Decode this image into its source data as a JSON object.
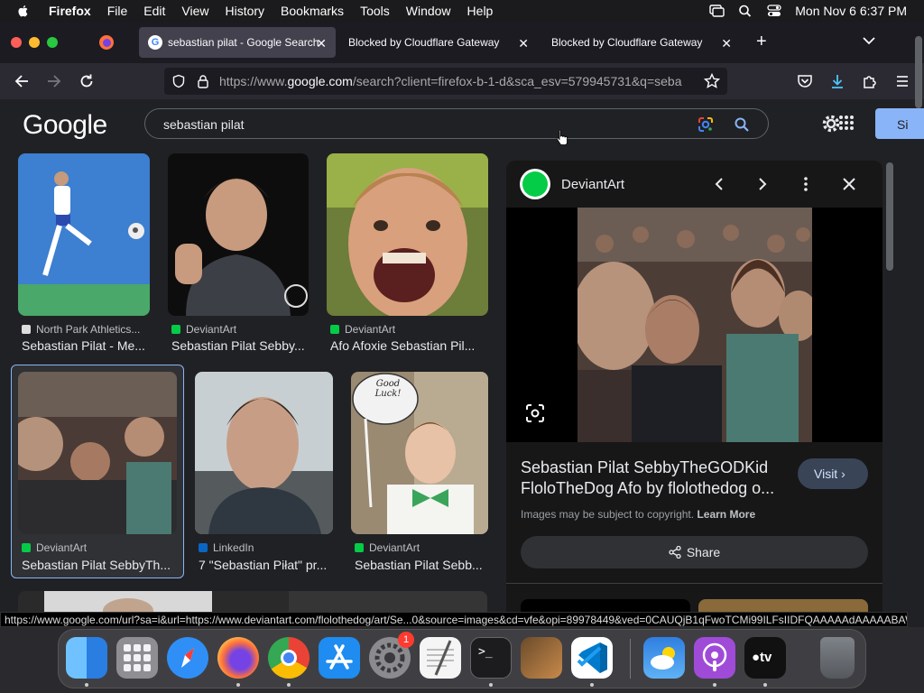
{
  "menubar": {
    "app": "Firefox",
    "items": [
      "File",
      "Edit",
      "View",
      "History",
      "Bookmarks",
      "Tools",
      "Window",
      "Help"
    ],
    "datetime": "Mon Nov 6  6:37 PM"
  },
  "tabs": [
    {
      "title": "sebastian pilat - Google Search",
      "active": true
    },
    {
      "title": "Blocked by Cloudflare Gateway",
      "active": false
    },
    {
      "title": "Blocked by Cloudflare Gateway",
      "active": false
    }
  ],
  "urlbar": {
    "prefix": "https://www.",
    "domain": "google.com",
    "rest": "/search?client=firefox-b-1-d&sca_esv=579945731&q=seba"
  },
  "google": {
    "logo": "Google",
    "query": "sebastian pilat",
    "signin": "Si"
  },
  "results": [
    {
      "source": "North Park Athletics...",
      "title": "Sebastian Pilat - Me..."
    },
    {
      "source": "DeviantArt",
      "title": "Sebastian Pilat Sebby..."
    },
    {
      "source": "DeviantArt",
      "title": "Afo Afoxie Sebastian Pil..."
    },
    {
      "source": "DeviantArt",
      "title": "Sebastian Pilat SebbyTh..."
    },
    {
      "source": "LinkedIn",
      "title": "7 \"Sebastian Piłat\" pr..."
    },
    {
      "source": "DeviantArt",
      "title": "Sebastian Pilat Sebb..."
    }
  ],
  "sticker_text": "Good Luck!",
  "panel": {
    "site": "DeviantArt",
    "title": "Sebastian Pilat SebbyTheGODKid FloloTheDog Afo by flolothedog o...",
    "visit": "Visit",
    "copyright": "Images may be subject to copyright.",
    "learn_more": "Learn More",
    "share": "Share"
  },
  "status_url": "https://www.google.com/url?sa=i&url=https://www.deviantart.com/flolothedog/art/Se...0&source=images&cd=vfe&opi=89978449&ved=0CAUQjB1qFwoTCMi99ILFsIIDFQAAAAAdAAAAABAW",
  "dock": [
    "Finder",
    "Launchpad",
    "Safari",
    "Firefox",
    "Chrome",
    "App Store",
    "System Settings",
    "TextEdit",
    "Terminal",
    "Instruments",
    "Visual Studio Code",
    "Weather",
    "Podcasts",
    "Apple TV",
    "Trash"
  ],
  "dock_badge": "1",
  "colors": {
    "accent": "#8ab4f8",
    "deviantart": "#05cc47",
    "background": "#202124"
  }
}
